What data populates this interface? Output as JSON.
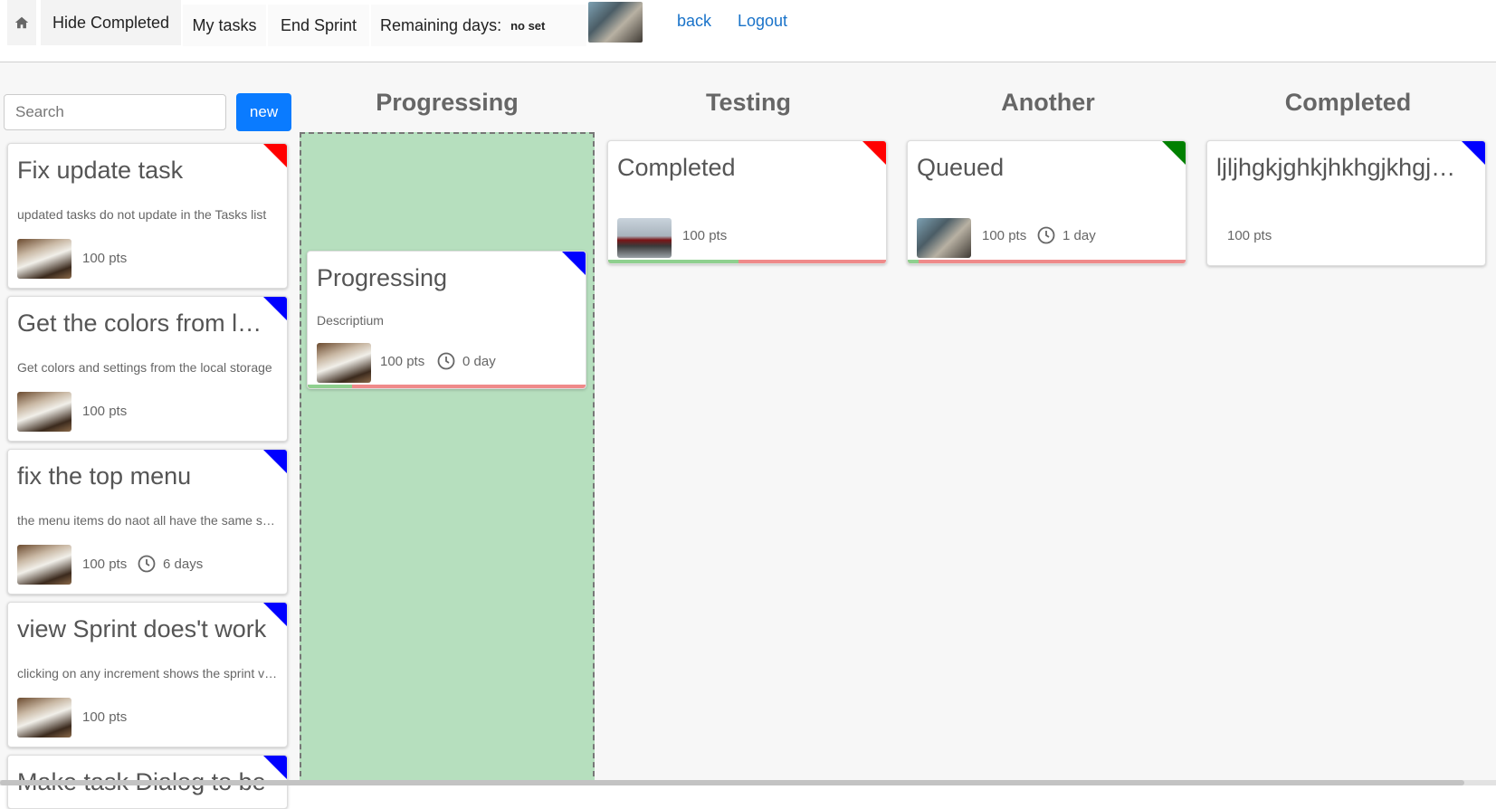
{
  "nav": {
    "hide_completed": "Hide Completed",
    "my_tasks": "My tasks",
    "end_sprint": "End Sprint",
    "remaining_label": "Remaining days:",
    "remaining_value": "no set",
    "back": "back",
    "logout": "Logout"
  },
  "backlog": {
    "search_placeholder": "Search",
    "new_label": "new",
    "cards": [
      {
        "title": "Fix update task",
        "desc": "updated tasks do not update in the Tasks list",
        "pts": "100 pts",
        "flag": "#ff0000"
      },
      {
        "title": "Get the colors from local storage",
        "desc": "Get colors and settings from the local storage",
        "pts": "100 pts",
        "flag": "#0000ff"
      },
      {
        "title": "fix the top menu",
        "desc": "the menu items do naot all have the same style",
        "pts": "100 pts",
        "days": "6 days",
        "flag": "#0000ff"
      },
      {
        "title": "view Sprint does't work",
        "desc": "clicking on any increment shows the sprint view",
        "pts": "100 pts",
        "flag": "#0000ff"
      },
      {
        "title": "Make task Dialog to be",
        "flag": "#0000ff"
      }
    ]
  },
  "columns": [
    {
      "name": "Progressing",
      "cards": [
        {
          "title": "Progressing",
          "desc": "Descriptium",
          "pts": "100 pts",
          "days": "0 day",
          "flag": "#0000ff",
          "progress": 0.16
        }
      ]
    },
    {
      "name": "Testing",
      "cards": [
        {
          "title": "Completed",
          "pts": "100 pts",
          "flag": "#ff0000",
          "progress": 0.47
        }
      ]
    },
    {
      "name": "Another",
      "cards": [
        {
          "title": "Queued",
          "pts": "100 pts",
          "days": "1 day",
          "flag": "#008000",
          "progress": 0.04
        }
      ]
    },
    {
      "name": "Completed",
      "cards": [
        {
          "title": "ljljhgkjghkjhkhgjkhgjkhgjkhg",
          "pts": "100 pts",
          "flag": "#0000ff"
        }
      ]
    }
  ],
  "colors": {
    "accent": "#0a7bff",
    "link": "#1a73c9",
    "drop_zone": "#b6dfbe",
    "progress_done": "#8fd08f",
    "progress_remaining": "#ef8a8a"
  }
}
